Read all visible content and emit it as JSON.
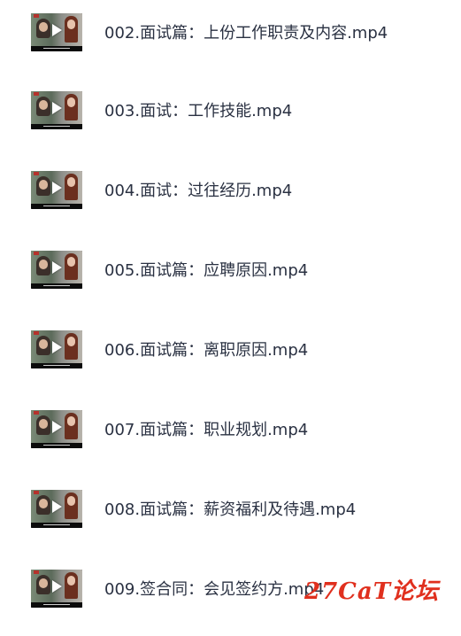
{
  "files": [
    {
      "name": "002.面试篇：上份工作职责及内容.mp4",
      "icon": "video-thumbnail-icon"
    },
    {
      "name": "003.面试：工作技能.mp4",
      "icon": "video-thumbnail-icon"
    },
    {
      "name": "004.面试：过往经历.mp4",
      "icon": "video-thumbnail-icon"
    },
    {
      "name": "005.面试篇：应聘原因.mp4",
      "icon": "video-thumbnail-icon"
    },
    {
      "name": "006.面试篇：离职原因.mp4",
      "icon": "video-thumbnail-icon"
    },
    {
      "name": "007.面试篇：职业规划.mp4",
      "icon": "video-thumbnail-icon"
    },
    {
      "name": "008.面试篇：薪资福利及待遇.mp4",
      "icon": "video-thumbnail-icon"
    },
    {
      "name": "009.签合同：会见签约方.mp4",
      "icon": "video-thumbnail-icon"
    }
  ],
  "watermark": {
    "text": "27CaT论坛",
    "color": "#e0301e"
  },
  "colors": {
    "text": "#2a3142",
    "background": "#ffffff"
  }
}
